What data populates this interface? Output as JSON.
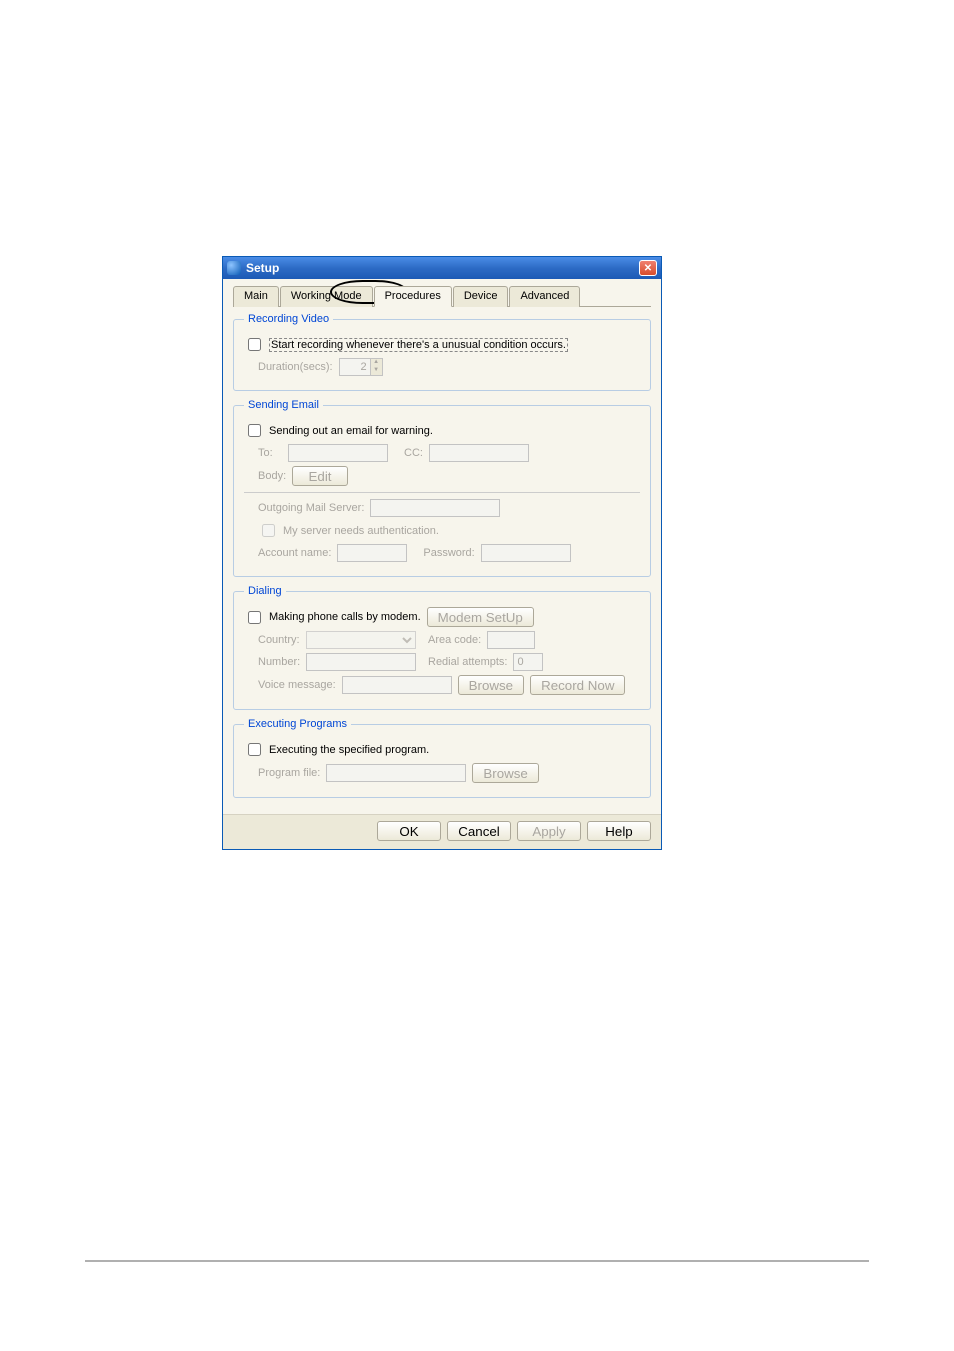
{
  "window": {
    "title": "Setup"
  },
  "tabs": {
    "main": "Main",
    "working_mode": "Working Mode",
    "procedures": "Procedures",
    "device": "Device",
    "advanced": "Advanced",
    "active": "procedures"
  },
  "recording_video": {
    "legend": "Recording Video",
    "start_recording": "Start recording whenever there's a unusual condition occurs.",
    "duration_label": "Duration(secs):",
    "duration_value": "2"
  },
  "sending_email": {
    "legend": "Sending Email",
    "enable": "Sending out an email for warning.",
    "to_label": "To:",
    "cc_label": "CC:",
    "body_label": "Body:",
    "edit_btn": "Edit",
    "server_label": "Outgoing Mail Server:",
    "auth_cb": "My server needs authentication.",
    "account_label": "Account name:",
    "password_label": "Password:"
  },
  "dialing": {
    "legend": "Dialing",
    "enable": "Making phone calls by modem.",
    "modem_setup_btn": "Modem SetUp",
    "country_label": "Country:",
    "area_code_label": "Area code:",
    "number_label": "Number:",
    "redial_label": "Redial attempts:",
    "redial_value": "0",
    "voice_msg_label": "Voice message:",
    "browse_btn": "Browse",
    "record_now_btn": "Record Now"
  },
  "executing": {
    "legend": "Executing Programs",
    "enable": "Executing the specified program.",
    "program_label": "Program file:",
    "browse_btn": "Browse"
  },
  "footer": {
    "ok": "OK",
    "cancel": "Cancel",
    "apply": "Apply",
    "help": "Help"
  }
}
